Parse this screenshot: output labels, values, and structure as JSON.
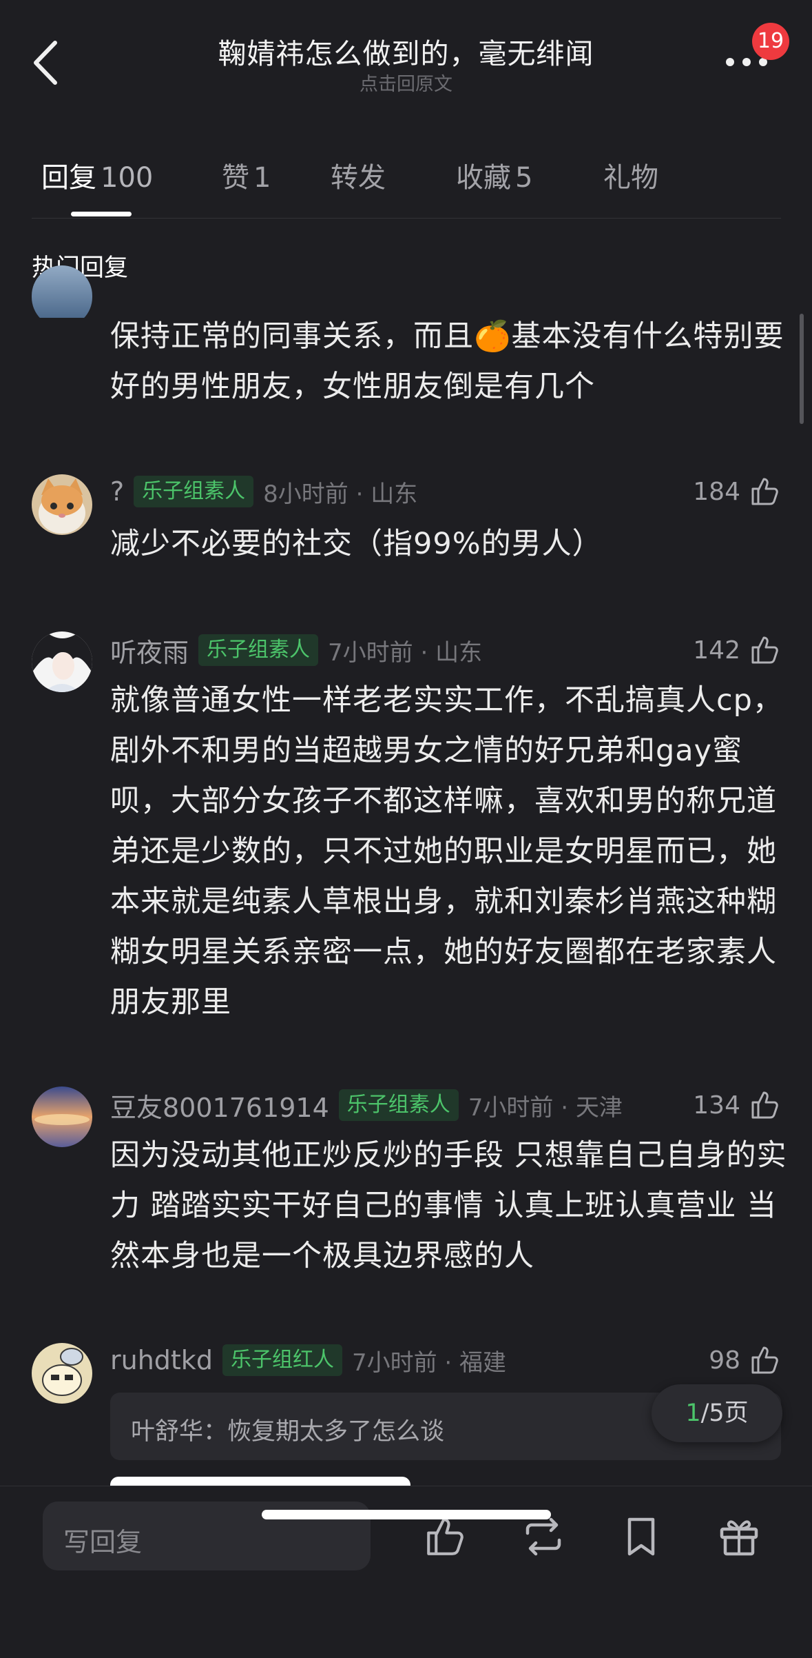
{
  "header": {
    "title": "鞠婧祎怎么做到的，毫无绯闻",
    "subtitle": "点击回原文",
    "notification_count": "19"
  },
  "tabs": [
    {
      "label": "回复",
      "count": "100"
    },
    {
      "label": "赞",
      "count": "1"
    },
    {
      "label": "转发",
      "count": ""
    },
    {
      "label": "收藏",
      "count": "5"
    },
    {
      "label": "礼物",
      "count": ""
    }
  ],
  "section_title": "热门回复",
  "comments": [
    {
      "text": "保持正常的同事关系，而且🍊基本没有什么特别要好的男性朋友，女性朋友倒是有几个"
    },
    {
      "username": "?",
      "tag": "乐子组素人",
      "time": "8小时前 · 山东",
      "likes": "184",
      "text": "减少不必要的社交（指99%的男人）"
    },
    {
      "username": "听夜雨",
      "tag": "乐子组素人",
      "time": "7小时前 · 山东",
      "likes": "142",
      "text": "就像普通女性一样老老实实工作，不乱搞真人cp，剧外不和男的当超越男女之情的好兄弟和gay蜜呗，大部分女孩子不都这样嘛，喜欢和男的称兄道弟还是少数的，只不过她的职业是女明星而已，她本来就是纯素人草根出身，就和刘秦杉肖燕这种糊糊女明星关系亲密一点，她的好友圈都在老家素人朋友那里"
    },
    {
      "username": "豆友8001761914",
      "tag": "乐子组素人",
      "time": "7小时前 · 天津",
      "likes": "134",
      "text": "因为没动其他正炒反炒的手段 只想靠自己自身的实力 踏踏实实干好自己的事情 认真上班认真营业 当然本身也是一个极具边界感的人"
    },
    {
      "username": "ruhdtkd",
      "tag": "乐子组红人",
      "time": "7小时前 · 福建",
      "likes": "98",
      "quote": "叶舒华：恢复期太多了怎么谈"
    }
  ],
  "pager": {
    "current": "1",
    "total": "/5页"
  },
  "bottom": {
    "reply_placeholder": "写回复"
  },
  "colors": {
    "background": "#1e1e22",
    "tag_green": "#4cc46a",
    "badge_red": "#ee3a3f"
  }
}
